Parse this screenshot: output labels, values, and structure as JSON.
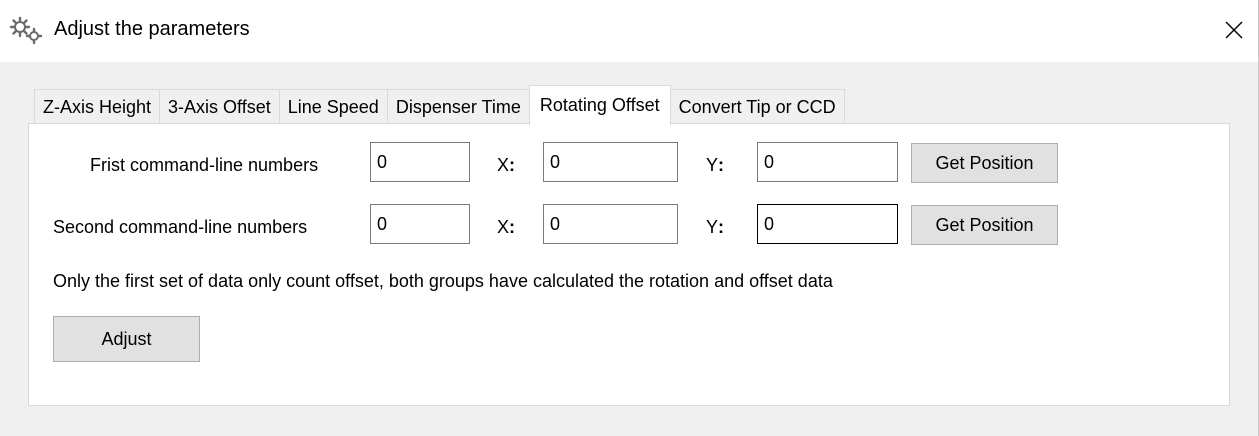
{
  "window": {
    "title": "Adjust the parameters",
    "icon": "gears-icon",
    "close_glyph": "✕"
  },
  "tabs": [
    {
      "label": "Z-Axis Height",
      "active": false
    },
    {
      "label": "3-Axis Offset",
      "active": false
    },
    {
      "label": "Line Speed",
      "active": false
    },
    {
      "label": "Dispenser Time",
      "active": false
    },
    {
      "label": "Rotating Offset",
      "active": true
    },
    {
      "label": "Convert Tip or CCD",
      "active": false
    }
  ],
  "rows": [
    {
      "label": "Frist command-line numbers",
      "number_value": "0",
      "x_label": "X",
      "x_value": "0",
      "y_label": "Y",
      "y_value": "0",
      "button_label": "Get Position"
    },
    {
      "label": "Second command-line numbers",
      "number_value": "0",
      "x_label": "X",
      "x_value": "0",
      "y_label": "Y",
      "y_value": "0",
      "button_label": "Get Position"
    }
  ],
  "colon": ":",
  "note": "Only the first set of data only count offset, both groups have calculated the rotation and offset data",
  "adjust_button_label": "Adjust",
  "colors": {
    "background": "#f0f0f0",
    "panel": "#ffffff",
    "button": "#e1e1e1",
    "border": "#d9d9d9"
  }
}
